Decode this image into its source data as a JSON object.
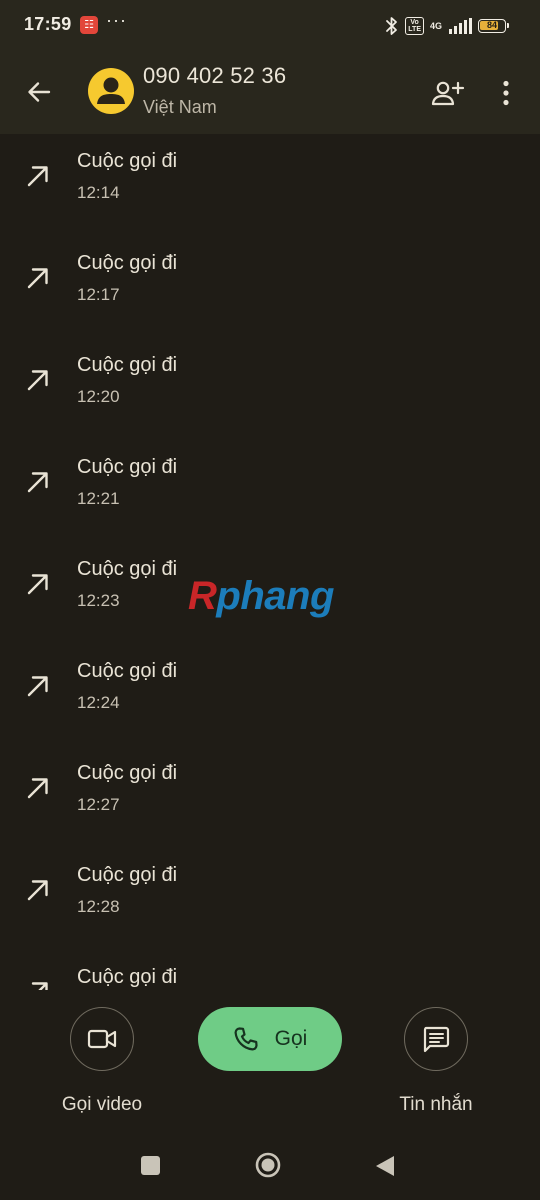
{
  "status_bar": {
    "time": "17:59",
    "app_icon_glyph": "☷",
    "more_glyph": "···",
    "volte_label": "Vo\nLTE",
    "network_label": "4G",
    "battery_level": "84",
    "battery_percent": 84,
    "battery_color": "#e6b03a"
  },
  "header": {
    "number": "090 402 52 36",
    "region": "Việt Nam",
    "avatar_color": "#f6c92f",
    "back_icon": "arrow-left-icon",
    "add_contact_icon": "person-add-icon",
    "more_icon": "more-vert-icon"
  },
  "calls": [
    {
      "type": "Cuộc gọi đi",
      "time": "12:14"
    },
    {
      "type": "Cuộc gọi đi",
      "time": "12:17"
    },
    {
      "type": "Cuộc gọi đi",
      "time": "12:20"
    },
    {
      "type": "Cuộc gọi đi",
      "time": "12:21"
    },
    {
      "type": "Cuộc gọi đi",
      "time": "12:23"
    },
    {
      "type": "Cuộc gọi đi",
      "time": "12:24"
    },
    {
      "type": "Cuộc gọi đi",
      "time": "12:27"
    },
    {
      "type": "Cuộc gọi đi",
      "time": "12:28"
    },
    {
      "type": "Cuộc gọi đi",
      "time": ""
    }
  ],
  "watermark": {
    "first": "R",
    "rest": "phang"
  },
  "actions": {
    "video_label": "Gọi video",
    "call_label": "Gọi",
    "message_label": "Tin nhắn",
    "call_color": "#6fcc86"
  },
  "colors": {
    "background": "#1f1c16",
    "app_bar": "#29271d",
    "text_primary": "#e9e3d5",
    "text_secondary": "#c7c0b2"
  }
}
